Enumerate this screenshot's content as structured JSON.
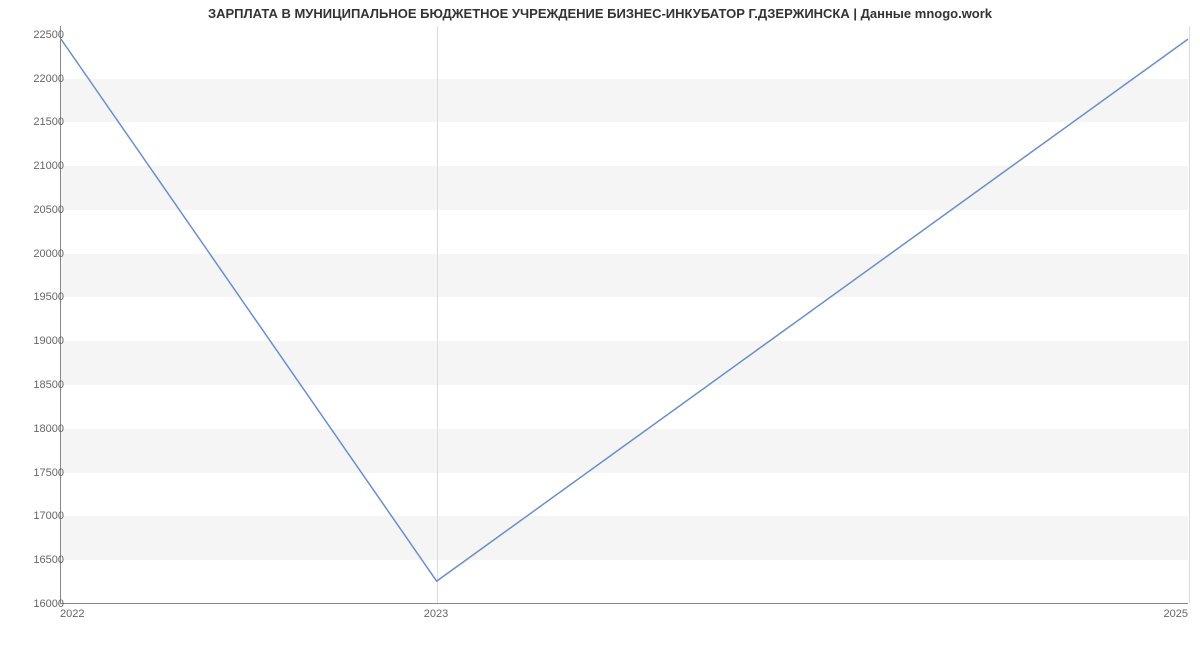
{
  "chart_data": {
    "type": "line",
    "title": "ЗАРПЛАТА В МУНИЦИПАЛЬНОЕ БЮДЖЕТНОЕ УЧРЕЖДЕНИЕ БИЗНЕС-ИНКУБАТОР Г.ДЗЕРЖИНСКА | Данные mnogo.work",
    "x": [
      2022,
      2023,
      2025
    ],
    "values": [
      22450,
      16250,
      22450
    ],
    "xlabel": "",
    "ylabel": "",
    "x_ticks": [
      2022,
      2023,
      2025
    ],
    "y_ticks": [
      16000,
      16500,
      17000,
      17500,
      18000,
      18500,
      19000,
      19500,
      20000,
      20500,
      21000,
      21500,
      22000,
      22500
    ],
    "xlim": [
      2022,
      2025
    ],
    "ylim": [
      16000,
      22600
    ],
    "series_color": "#6b8ecf"
  }
}
